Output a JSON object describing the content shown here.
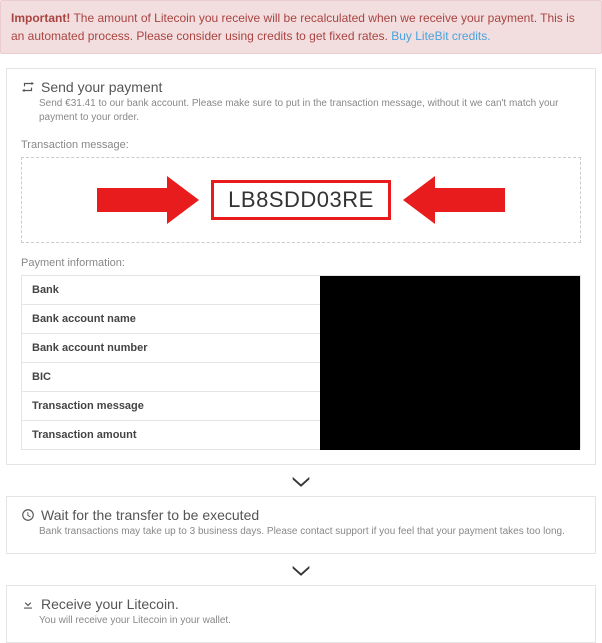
{
  "alert": {
    "strong": "Important!",
    "text": " The amount of Litecoin you receive will be recalculated when we receive your payment. This is an automated process. Please consider using credits to get fixed rates.   ",
    "link": "Buy LiteBit credits."
  },
  "step1": {
    "title": "Send your payment",
    "subtitle": "Send €31.41 to our bank account. Please make sure to put in the transaction message, without it we can't match your payment to your order.",
    "txn_label": "Transaction message:",
    "txn_code": "LB8SDD03RE",
    "pay_label": "Payment information:",
    "rows": {
      "r0": "Bank",
      "r1": "Bank account name",
      "r2": "Bank account number",
      "r3": "BIC",
      "r4": "Transaction message",
      "r5": "Transaction amount"
    }
  },
  "step2": {
    "title": "Wait for the transfer to be executed",
    "subtitle": "Bank transactions may take up to 3 business days. Please contact support if you feel that your payment takes too long."
  },
  "step3": {
    "title": "Receive your Litecoin.",
    "subtitle": "You will receive your Litecoin in your wallet."
  }
}
